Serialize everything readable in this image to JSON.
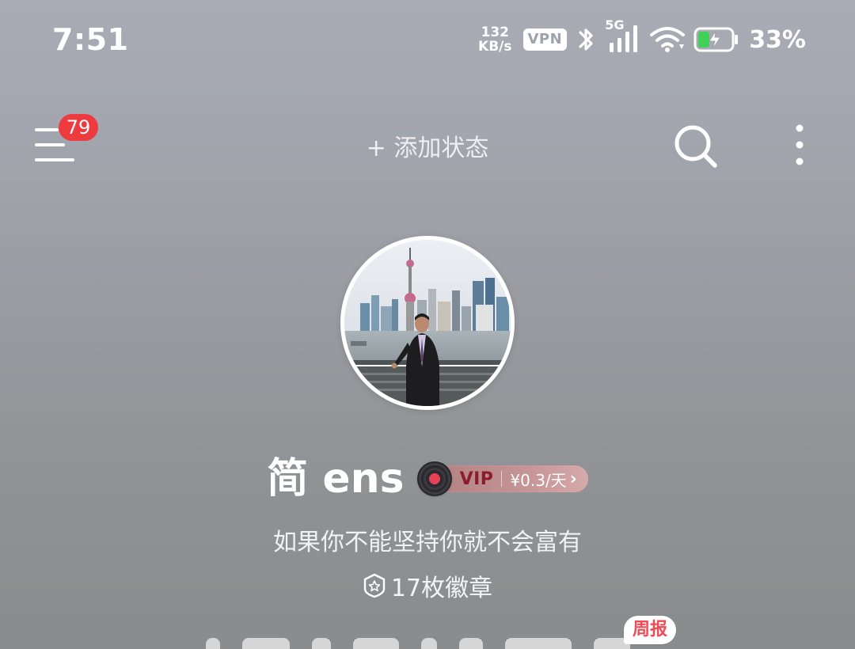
{
  "status_bar": {
    "time": "7:51",
    "net_speed_value": "132",
    "net_speed_unit": "KB/s",
    "vpn": "VPN",
    "network_type": "5G",
    "battery_percent": "33%",
    "battery_level": 0.33,
    "icons": [
      "bluetooth-icon",
      "cellular-signal-icon",
      "wifi-icon",
      "battery-charging-icon"
    ]
  },
  "nav": {
    "menu_badge": "79",
    "add_status": "+ 添加状态",
    "icons": [
      "menu-icon",
      "search-icon",
      "more-vertical-icon"
    ]
  },
  "profile": {
    "username": "简 ens",
    "vip": {
      "label": "VIP",
      "price": "¥0.3/天",
      "arrow": "›",
      "icon": "vinyl-disc-icon"
    },
    "bio": "如果你不能坚持你就不会富有",
    "badges_text": "17枚徽章",
    "badges_icon": "badge-medal-icon",
    "weekly_tag": "周报"
  },
  "colors": {
    "background_top": "#a9acb5",
    "background_bottom": "#8a8b8d",
    "badge_red": "#ee3b40",
    "vip_text": "#8a1c2f",
    "weekly_tag_text": "#ef4b57"
  }
}
